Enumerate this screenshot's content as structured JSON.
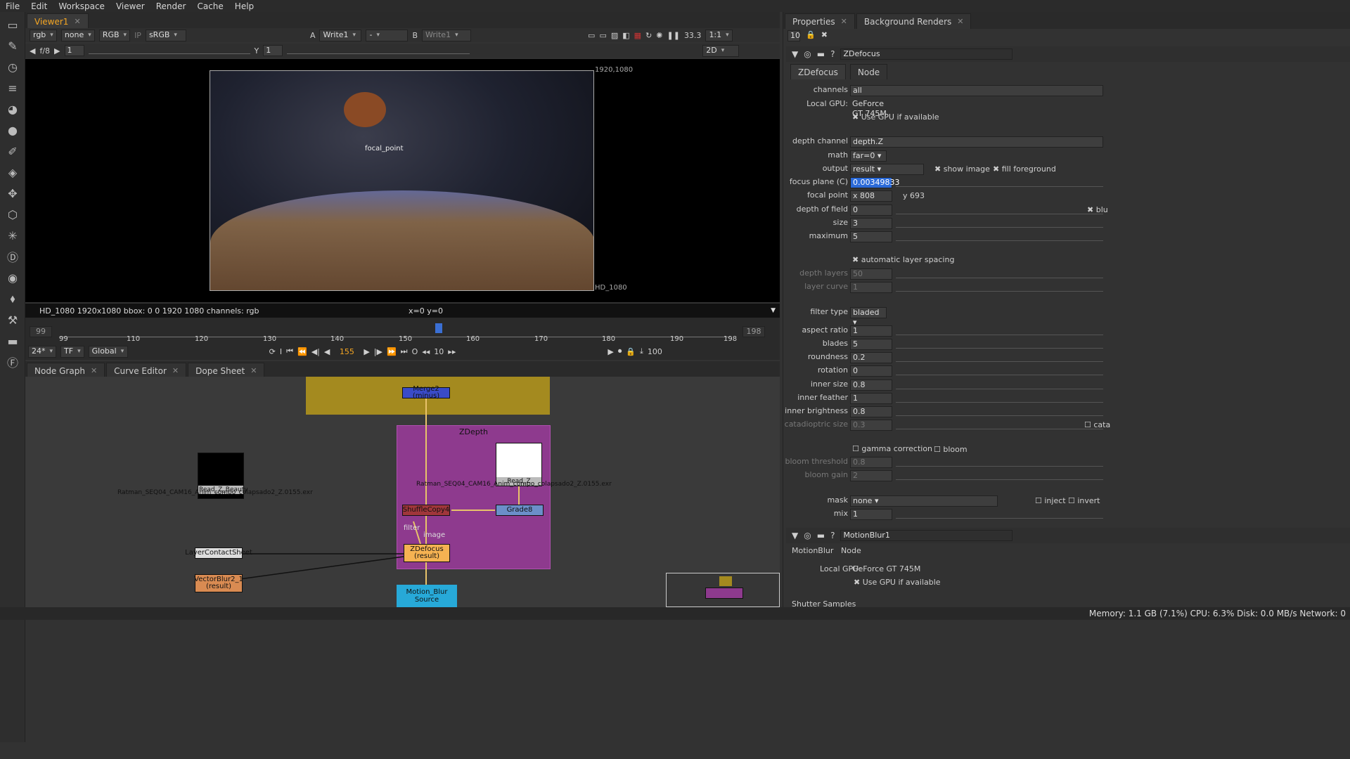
{
  "menu": [
    "File",
    "Edit",
    "Workspace",
    "Viewer",
    "Render",
    "Cache",
    "Help"
  ],
  "viewer_tab": "Viewer1",
  "viewer_bar": {
    "channels": "rgb",
    "alpha": "none",
    "rgb_mode": "RGB",
    "ip": "IP",
    "lut": "sRGB",
    "a_label": "A",
    "a_input": "Write1",
    "dash": "-",
    "b_label": "B",
    "b_input": "Write1",
    "zoom": "33.3",
    "ratio": "1:1",
    "fstop": "f/8",
    "gain": "1",
    "y_label": "Y",
    "gamma": "1",
    "view_mode": "2D"
  },
  "viewer": {
    "corner_label": "1920,1080",
    "format_label": "HD_1080",
    "focal_label": "focal_point"
  },
  "infobar": {
    "left": "HD_1080 1920x1080  bbox: 0 0 1920 1080 channels: rgb",
    "center": "x=0 y=0"
  },
  "timeline": {
    "start": "99",
    "end": "198",
    "in": "99",
    "out": "198",
    "current": "155",
    "ticks": [
      "99",
      "110",
      "120",
      "130",
      "140",
      "150",
      "160",
      "170",
      "180",
      "190",
      "198"
    ],
    "fps": "24*",
    "tf": "TF",
    "scope": "Global",
    "step": "10",
    "playrange": "100",
    "i": "I",
    "o": "O"
  },
  "graph_tabs": [
    "Node Graph",
    "Curve Editor",
    "Dope Sheet"
  ],
  "graph": {
    "backdrop_zdepth": "ZDepth",
    "merge": "Merge2 (minus)",
    "read_beauty": "Read_Z_Beauty",
    "read_beauty_file": "Ratman_SEQ04_CAM16_Anim_compo_colapsado2_Z.0155.exr",
    "read_z": "Read_Z",
    "read_z_file": "Ratman_SEQ04_CAM16_Anim_compo_colapsado2_Z.0155.exr",
    "shuffle": "ShuffleCopy4",
    "grade": "Grade8",
    "filter": "filter",
    "image": "image",
    "zdefocus": "ZDefocus",
    "zdefocus_sub": "(result)",
    "layer_sheet": "LayerContactSheet",
    "vectorblur": "VectorBlur2_1",
    "vectorblur_sub": "(result)",
    "motion_blur": "Motion_Blur",
    "motion_blur_sub": "Source"
  },
  "prop_tabs": [
    "Properties",
    "Background Renders"
  ],
  "prop_count": "10",
  "zdefocus_panel": {
    "name": "ZDefocus",
    "tabs": [
      "ZDefocus",
      "Node"
    ],
    "rows": [
      {
        "label": "channels",
        "value": "all"
      },
      {
        "label": "Local GPU:",
        "value": "GeForce GT 745M"
      },
      {
        "label": "",
        "value": "Use GPU if available"
      },
      {
        "label": "depth channel",
        "value": "depth.Z"
      },
      {
        "label": "math",
        "value": "far=0"
      },
      {
        "label": "output",
        "value": "result"
      },
      {
        "label": "focus plane (C)",
        "value": "0.00349833"
      },
      {
        "label": "focal point",
        "value": "808"
      },
      {
        "label": "depth of field",
        "value": "0"
      },
      {
        "label": "size",
        "value": "3"
      },
      {
        "label": "maximum",
        "value": "5"
      },
      {
        "label": "",
        "value": "automatic layer spacing"
      },
      {
        "label": "depth layers",
        "value": "50"
      },
      {
        "label": "layer curve",
        "value": "1"
      },
      {
        "label": "filter type",
        "value": "bladed"
      },
      {
        "label": "aspect ratio",
        "value": "1"
      },
      {
        "label": "blades",
        "value": "5"
      },
      {
        "label": "roundness",
        "value": "0.2"
      },
      {
        "label": "rotation",
        "value": "0"
      },
      {
        "label": "inner size",
        "value": "0.8"
      },
      {
        "label": "inner feather",
        "value": "1"
      },
      {
        "label": "inner brightness",
        "value": "0.8"
      },
      {
        "label": "catadioptric size",
        "value": "0.3"
      },
      {
        "label": "",
        "value": "gamma correction"
      },
      {
        "label": "bloom threshold",
        "value": "0.8"
      },
      {
        "label": "bloom gain",
        "value": "2"
      },
      {
        "label": "mask",
        "value": "none"
      },
      {
        "label": "mix",
        "value": "1"
      }
    ],
    "show_image": "show image",
    "fill_foreground": "fill foreground",
    "focal_y": "693",
    "x_label": "x",
    "y_label": "y",
    "blur_label": "blu",
    "bloom": "bloom",
    "inject": "inject",
    "invert": "invert",
    "cata": "cata"
  },
  "motionblur_panel": {
    "name": "MotionBlur1",
    "tabs": [
      "MotionBlur",
      "Node"
    ],
    "gpu_label": "Local GPU:",
    "gpu_value": "GeForce GT 745M",
    "use_gpu": "Use GPU if available",
    "shutter": "Shutter Samples"
  },
  "status": "Memory: 1.1 GB (7.1%)  CPU: 6.3%  Disk: 0.0 MB/s  Network: 0"
}
